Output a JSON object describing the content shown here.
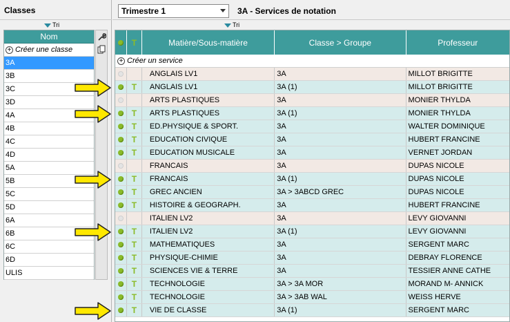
{
  "left_panel": {
    "title": "Classes",
    "sort_label": "Tri",
    "column_header": "Nom",
    "create_label": "Créer une classe",
    "classes": [
      "3A",
      "3B",
      "3C",
      "3D",
      "4A",
      "4B",
      "4C",
      "4D",
      "5A",
      "5B",
      "5C",
      "5D",
      "6A",
      "6B",
      "6C",
      "6D",
      "ULIS"
    ],
    "selected_class": "3A"
  },
  "toolbar": {
    "period_value": "Trimestre 1",
    "page_title": "3A - Services de notation",
    "sort_label": "Tri"
  },
  "grid": {
    "headers": {
      "matiere": "Matière/Sous-matière",
      "classe": "Classe > Groupe",
      "professeur": "Professeur"
    },
    "create_label": "Créer un service",
    "rows": [
      {
        "active": false,
        "matiere": "ANGLAIS LV1",
        "classe": "3A",
        "professeur": "MILLOT BRIGITTE",
        "arrow": false
      },
      {
        "active": true,
        "matiere": "ANGLAIS LV1",
        "classe": "3A (1)",
        "professeur": "MILLOT BRIGITTE",
        "arrow": true
      },
      {
        "active": false,
        "matiere": "ARTS PLASTIQUES",
        "classe": "3A",
        "professeur": "MONIER THYLDA",
        "arrow": false
      },
      {
        "active": true,
        "matiere": "ARTS PLASTIQUES",
        "classe": "3A (1)",
        "professeur": "MONIER THYLDA",
        "arrow": true
      },
      {
        "active": true,
        "matiere": "ED.PHYSIQUE & SPORT.",
        "classe": "3A",
        "professeur": "WALTER DOMINIQUE",
        "arrow": false
      },
      {
        "active": true,
        "matiere": "EDUCATION CIVIQUE",
        "classe": "3A",
        "professeur": "HUBERT FRANCINE",
        "arrow": false
      },
      {
        "active": true,
        "matiere": "EDUCATION MUSICALE",
        "classe": "3A",
        "professeur": "VERNET JORDAN",
        "arrow": false
      },
      {
        "active": false,
        "matiere": "FRANCAIS",
        "classe": "3A",
        "professeur": "DUPAS NICOLE",
        "arrow": false
      },
      {
        "active": true,
        "matiere": "FRANCAIS",
        "classe": "3A (1)",
        "professeur": "DUPAS NICOLE",
        "arrow": true
      },
      {
        "active": true,
        "matiere": "GREC ANCIEN",
        "classe": "3A > 3ABCD GREC",
        "professeur": "DUPAS NICOLE",
        "arrow": false
      },
      {
        "active": true,
        "matiere": "HISTOIRE & GEOGRAPH.",
        "classe": "3A",
        "professeur": "HUBERT FRANCINE",
        "arrow": false
      },
      {
        "active": false,
        "matiere": "ITALIEN LV2",
        "classe": "3A",
        "professeur": "LEVY GIOVANNI",
        "arrow": false
      },
      {
        "active": true,
        "matiere": "ITALIEN LV2",
        "classe": "3A (1)",
        "professeur": "LEVY GIOVANNI",
        "arrow": true
      },
      {
        "active": true,
        "matiere": "MATHEMATIQUES",
        "classe": "3A",
        "professeur": "SERGENT MARC",
        "arrow": false
      },
      {
        "active": true,
        "matiere": "PHYSIQUE-CHIMIE",
        "classe": "3A",
        "professeur": "DEBRAY FLORENCE",
        "arrow": false
      },
      {
        "active": true,
        "matiere": "SCIENCES VIE & TERRE",
        "classe": "3A",
        "professeur": "TESSIER ANNE CATHE",
        "arrow": false
      },
      {
        "active": true,
        "matiere": "TECHNOLOGIE",
        "classe": "3A > 3A MOR",
        "professeur": "MORAND M- ANNICK",
        "arrow": false
      },
      {
        "active": true,
        "matiere": "TECHNOLOGIE",
        "classe": "3A > 3AB WAL",
        "professeur": "WEISS HERVE",
        "arrow": false
      },
      {
        "active": true,
        "matiere": "VIE DE CLASSE",
        "classe": "3A (1)",
        "professeur": "SERGENT MARC",
        "arrow": true
      }
    ]
  },
  "icons": {
    "tool_top": "wrench-icon",
    "tool_second": "copy-icon",
    "row_status": "status-dot-icon",
    "row_type": "t-icon",
    "annotation": "yellow-arrow-icon"
  },
  "colors": {
    "header_teal": "#3e9c9c",
    "selected_blue": "#3399ff",
    "row_even": "#f2e9e4",
    "row_odd": "#d5ecec",
    "active_green": "#8bbb2a",
    "arrow_yellow": "#ffe800"
  }
}
